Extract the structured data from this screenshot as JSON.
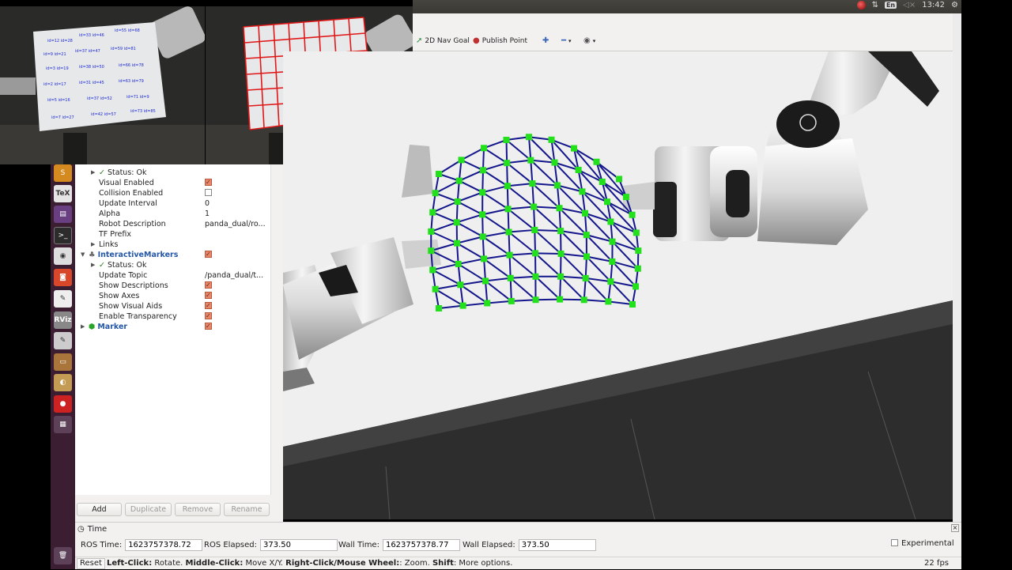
{
  "taskbar": {
    "time": "13:42",
    "lang": "En"
  },
  "toolbar": {
    "nav_goal": "2D Nav Goal",
    "publish_point": "Publish Point"
  },
  "tree": {
    "status_ok_1": "Status: Ok",
    "visual_enabled": "Visual Enabled",
    "collision_enabled": "Collision Enabled",
    "update_interval": "Update Interval",
    "update_interval_value": "0",
    "alpha": "Alpha",
    "alpha_value": "1",
    "robot_description": "Robot Description",
    "robot_description_value": "panda_dual/ro...",
    "tf_prefix": "TF Prefix",
    "links": "Links",
    "interactive_markers": "InteractiveMarkers",
    "status_ok_2": "Status: Ok",
    "update_topic": "Update Topic",
    "update_topic_value": "/panda_dual/t...",
    "show_descriptions": "Show Descriptions",
    "show_axes": "Show Axes",
    "show_visual_aids": "Show Visual Aids",
    "enable_transparency": "Enable Transparency",
    "marker": "Marker"
  },
  "buttons": {
    "add": "Add",
    "duplicate": "Duplicate",
    "remove": "Remove",
    "rename": "Rename"
  },
  "time": {
    "title": "Time",
    "ros_time_label": "ROS Time:",
    "ros_time": "1623757378.72",
    "ros_elapsed_label": "ROS Elapsed:",
    "ros_elapsed": "373.50",
    "wall_time_label": "Wall Time:",
    "wall_time": "1623757378.77",
    "wall_elapsed_label": "Wall Elapsed:",
    "wall_elapsed": "373.50",
    "experimental": "Experimental"
  },
  "status": {
    "reset": "Reset",
    "hint_left_b": "Left-Click:",
    "hint_left": " Rotate. ",
    "hint_mid_b": "Middle-Click:",
    "hint_mid": " Move X/Y. ",
    "hint_right_b": "Right-Click/Mouse Wheel:",
    "hint_right": ": Zoom. ",
    "hint_shift_b": "Shift",
    "hint_shift": ": More options.",
    "fps": "22 fps"
  },
  "colors": {
    "mesh_edge": "#14168c",
    "mesh_node": "#22e01a",
    "grid_red": "#e01818",
    "checkbox_on": "#e9866a",
    "launcher_bg": "#3c1e33"
  }
}
